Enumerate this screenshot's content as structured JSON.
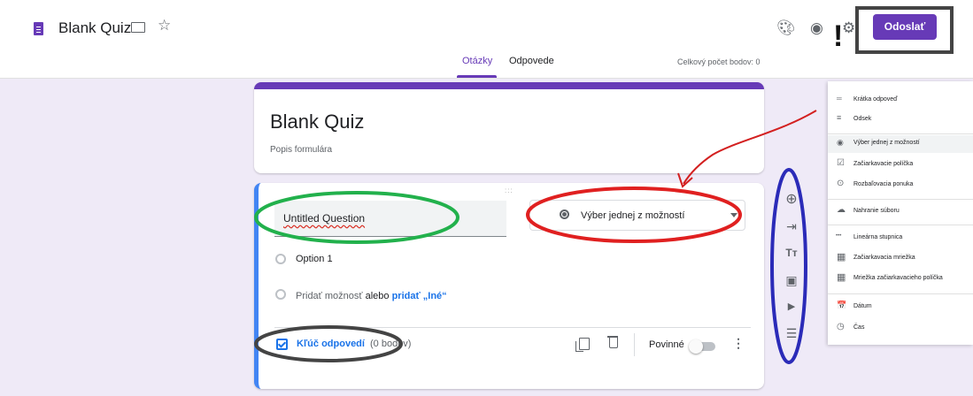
{
  "header": {
    "title": "Blank Quiz",
    "send_label": "Odoslať",
    "exclaim": "!",
    "icons": [
      "palette-icon",
      "eye-icon",
      "gear-icon"
    ]
  },
  "tabs": [
    {
      "label": "Otázky",
      "active": true
    },
    {
      "label": "Odpovede",
      "active": false
    }
  ],
  "total_points": "Celkový počet bodov: 0",
  "form": {
    "title": "Blank Quiz",
    "description": "Popis formulára"
  },
  "question": {
    "title": "Untitled Question",
    "type": "Výber jednej z možností",
    "options": [
      "Option 1"
    ],
    "add_option": "Pridať možnosť",
    "add_or": "alebo",
    "add_other": "pridať „Iné“",
    "answer_key": "Kľúč odpovedí",
    "points": "(0 bodov)",
    "required": "Povinné",
    "drag_handle": ":::"
  },
  "toolbar": {
    "icons": [
      "add-question-icon",
      "import-question-icon",
      "title-text-icon",
      "image-icon",
      "video-icon",
      "section-icon"
    ],
    "glyphs": [
      "⊕",
      "⇥",
      "Tт",
      "▣",
      "▶",
      "☰"
    ]
  },
  "type_menu": {
    "items": [
      {
        "label": "Krátka odpoveď",
        "icon": "short-answer-icon",
        "glyph": "═"
      },
      {
        "label": "Odsek",
        "icon": "paragraph-icon",
        "glyph": "≡"
      },
      {
        "label": "Výber jednej z možností",
        "icon": "radio-icon",
        "glyph": "◉",
        "selected": true
      },
      {
        "label": "Začiarkavacie políčka",
        "icon": "checkbox-icon",
        "glyph": "☑"
      },
      {
        "label": "Rozbaľovacia ponuka",
        "icon": "dropdown-icon",
        "glyph": "⊙"
      },
      {
        "label": "Nahranie súboru",
        "icon": "cloud-upload-icon",
        "glyph": "☁"
      },
      {
        "label": "Lineárna stupnica",
        "icon": "linear-scale-icon",
        "glyph": "•••"
      },
      {
        "label": "Začiarkavacia mriežka",
        "icon": "grid-icon",
        "glyph": "▦"
      },
      {
        "label": "Mriežka začiarkavacieho políčka",
        "icon": "checkbox-grid-icon",
        "glyph": "▦"
      },
      {
        "label": "Dátum",
        "icon": "calendar-icon",
        "glyph": "📅"
      },
      {
        "label": "Čas",
        "icon": "clock-icon",
        "glyph": "◷"
      }
    ]
  },
  "colors": {
    "accent": "#673ab7",
    "link": "#1a73e8",
    "annot_green": "#22b14c",
    "annot_red": "#e02020",
    "annot_blue": "#2b2bb8",
    "annot_dark": "#444444"
  }
}
